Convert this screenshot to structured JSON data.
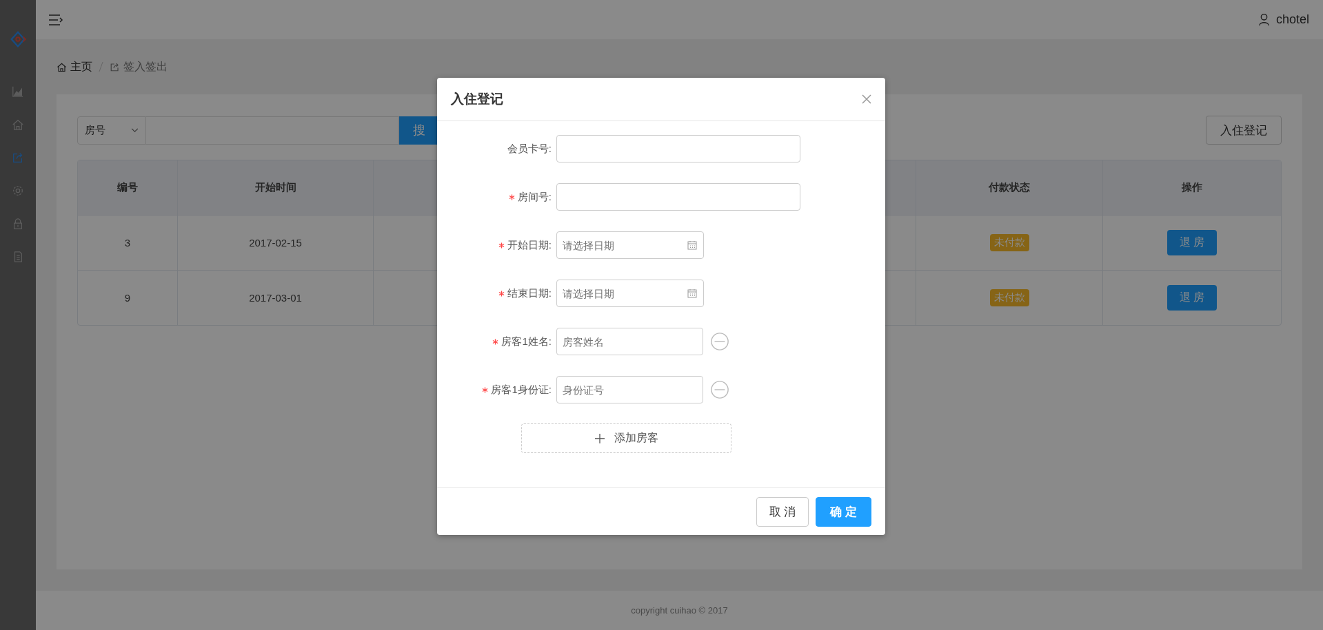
{
  "sidebar": {
    "items": [
      {
        "selected": false
      },
      {
        "selected": false
      },
      {
        "selected": true
      },
      {
        "selected": false
      },
      {
        "selected": false
      },
      {
        "selected": false
      }
    ]
  },
  "header": {
    "user": "chotel"
  },
  "breadcrumb": [
    {
      "label": "主页"
    },
    {
      "label": "签入签出"
    }
  ],
  "search": {
    "filter": "房号",
    "button": "搜"
  },
  "register_button": "入住登记",
  "table": {
    "columns": [
      "编号",
      "开始时间",
      "",
      "付款状态",
      "操作"
    ],
    "rows": [
      {
        "id": "3",
        "start": "2017-02-15",
        "status": "未付款",
        "action": "退 房"
      },
      {
        "id": "9",
        "start": "2017-03-01",
        "status": "未付款",
        "action": "退 房"
      }
    ]
  },
  "footer": "copyright cuihao © 2017",
  "dialog": {
    "title": "入住登记",
    "fields": [
      {
        "kind": "text",
        "label": "会员卡号:",
        "required": false
      },
      {
        "kind": "text",
        "label": "房间号:",
        "required": true
      },
      {
        "kind": "date",
        "label": "开始日期:",
        "required": true,
        "placeholder": "请选择日期"
      },
      {
        "kind": "date",
        "label": "结束日期:",
        "required": true,
        "placeholder": "请选择日期"
      },
      {
        "kind": "removable",
        "label": "房客1姓名:",
        "required": true,
        "placeholder": "房客姓名"
      },
      {
        "kind": "removable",
        "label": "房客1身份证:",
        "required": true,
        "placeholder": "身份证号"
      }
    ],
    "add_button": "添加房客",
    "cancel": "取 消",
    "confirm": "确 定"
  }
}
